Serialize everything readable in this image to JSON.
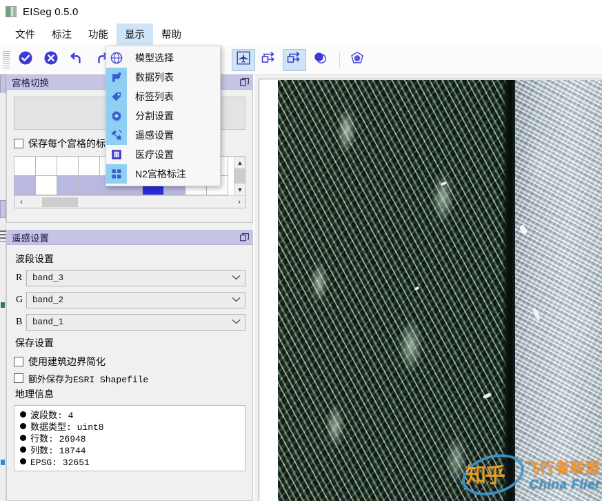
{
  "window": {
    "title": "EISeg 0.5.0",
    "icon": "app-icon"
  },
  "menubar": {
    "items": [
      {
        "label": "文件",
        "active": false
      },
      {
        "label": "标注",
        "active": false
      },
      {
        "label": "功能",
        "active": false
      },
      {
        "label": "显示",
        "active": true
      },
      {
        "label": "帮助",
        "active": false
      }
    ]
  },
  "toolbar": {
    "buttons": [
      {
        "name": "confirm-icon",
        "glyph": "check-circle",
        "selected": false
      },
      {
        "name": "cancel-icon",
        "glyph": "x-circle",
        "selected": false
      },
      {
        "name": "undo-icon",
        "glyph": "undo",
        "selected": false
      },
      {
        "name": "redo-icon",
        "glyph": "redo",
        "selected": false
      },
      {
        "name": "airplane-icon",
        "glyph": "airplane",
        "selected": true
      },
      {
        "name": "prev-transfer-icon",
        "glyph": "arrow-transfer-left",
        "selected": false
      },
      {
        "name": "next-transfer-icon",
        "glyph": "arrow-transfer-right",
        "selected": false
      },
      {
        "name": "circle-overlap-icon",
        "glyph": "circles",
        "selected": false
      },
      {
        "name": "polygon-icon",
        "glyph": "polygon",
        "selected": false
      }
    ]
  },
  "dropdown": {
    "owner": "显示",
    "items": [
      {
        "label": "模型选择",
        "icon": "model-select-icon",
        "highlighted": false
      },
      {
        "label": "数据列表",
        "icon": "data-list-icon",
        "highlighted": true
      },
      {
        "label": "标签列表",
        "icon": "label-tag-icon",
        "highlighted": true
      },
      {
        "label": "分割设置",
        "icon": "gear-icon",
        "highlighted": true
      },
      {
        "label": "遥感设置",
        "icon": "satellite-icon",
        "highlighted": true
      },
      {
        "label": "医疗设置",
        "icon": "medical-icon",
        "highlighted": false
      },
      {
        "label": "N2宫格标注",
        "icon": "grid-four-icon",
        "highlighted": true
      }
    ]
  },
  "grid_panel": {
    "title": "宫格切换",
    "float_icon": "float-window-icon",
    "button_label": "",
    "checkbox": {
      "label": "保存每个宫格的标注",
      "checked": false
    },
    "cells": [
      [
        "white",
        "white",
        "white",
        "white",
        "white",
        "white",
        "white",
        "white",
        "white",
        "white"
      ],
      [
        "light",
        "white",
        "light",
        "light",
        "light",
        "light",
        "sel",
        "light",
        "white",
        "white"
      ]
    ],
    "scroll": {
      "up": "▲",
      "down": "▼",
      "left": "‹",
      "right": "›"
    }
  },
  "rs_panel": {
    "title": "遥感设置",
    "float_icon": "float-window-icon",
    "band_section_label": "波段设置",
    "bands": [
      {
        "key": "R",
        "value": "band_3"
      },
      {
        "key": "G",
        "value": "band_2"
      },
      {
        "key": "B",
        "value": "band_1"
      }
    ],
    "save_section_label": "保存设置",
    "save_options": [
      {
        "label": "使用建筑边界简化",
        "checked": false
      },
      {
        "label": "额外保存为ESRI Shapefile",
        "checked": false
      }
    ],
    "geo_section_label": "地理信息",
    "geo_info": [
      "波段数: 4",
      "数据类型: uint8",
      "行数: 26948",
      "列数: 18744",
      "EPSG: 32651"
    ]
  },
  "canvas": {
    "name": "image-viewport",
    "content": "aerial-image-grass-and-pavement"
  },
  "watermark": {
    "zhihu": "知乎",
    "cn": "飞行者联盟",
    "en": "China Flier"
  },
  "colors": {
    "accent_blue": "#3a3ad0",
    "dock_title": "#c7c5e4",
    "menu_highlight": "#cfe4f7",
    "icon_highlight": "#8fd0f2",
    "selected_cell": "#2a2ae0",
    "light_cell": "#b9b8e0"
  }
}
